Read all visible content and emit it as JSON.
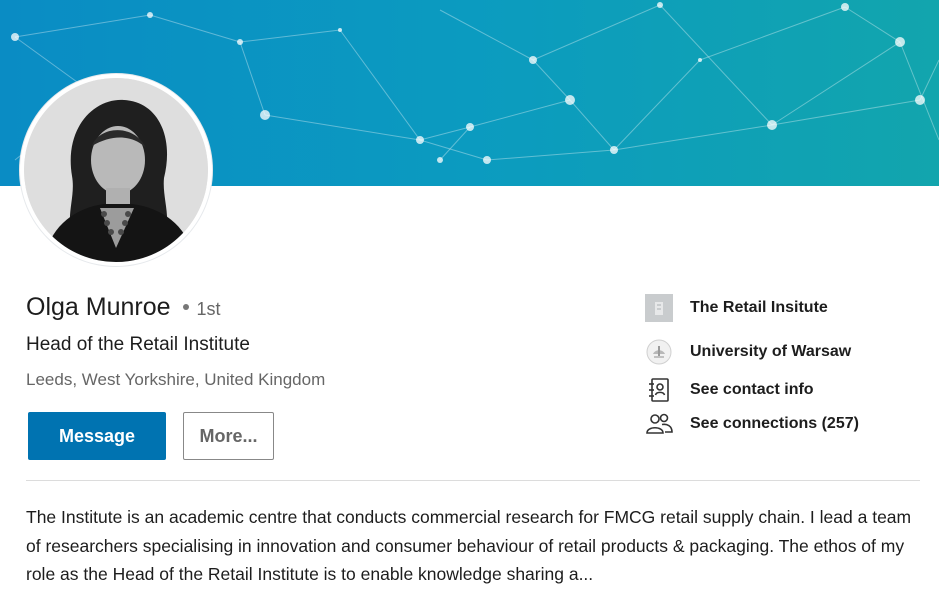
{
  "profile": {
    "name": "Olga Munroe",
    "degree": "1st",
    "headline": "Head of the Retail Institute",
    "location": "Leeds, West Yorkshire, United Kingdom"
  },
  "actions": {
    "message_label": "Message",
    "more_label": "More..."
  },
  "sidebar": {
    "company": "The Retail Insitute",
    "school": "University of Warsaw",
    "contact_info": "See contact info",
    "connections": "See connections (257)"
  },
  "icons": {
    "company": "building-icon",
    "school": "university-crest-icon",
    "contact": "contact-card-icon",
    "connections": "people-icon"
  },
  "colors": {
    "banner": "#0b9bc0",
    "primary_button": "#0073b1"
  },
  "summary": {
    "text": "The Institute is an academic centre that conducts commercial research for FMCG retail supply chain. I lead a team of researchers specialising in innovation and consumer behaviour of retail products & packaging. The ethos of my role as the Head of the Retail Institute is to enable knowledge sharing a..."
  }
}
